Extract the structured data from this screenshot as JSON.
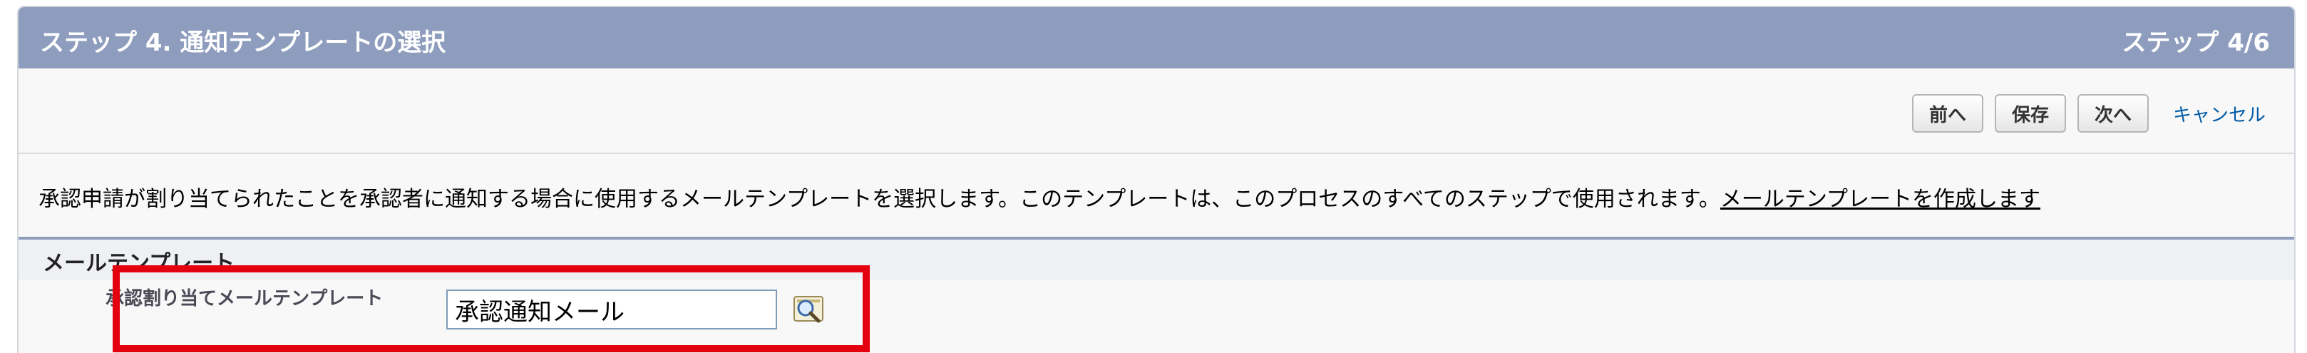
{
  "header": {
    "title": "ステップ 4. 通知テンプレートの選択",
    "step": "ステップ 4/6"
  },
  "buttons": {
    "prev_label": "前へ",
    "save_label": "保存",
    "next_label": "次へ",
    "cancel_label": "キャンセル"
  },
  "description": {
    "text": "承認申請が割り当てられたことを承認者に通知する場合に使用するメールテンプレートを選択します。このテンプレートは、このプロセスのすべてのステップで使用されます。",
    "link_text": "メールテンプレートを作成します"
  },
  "section": {
    "title": "メールテンプレート"
  },
  "field": {
    "label": "承認割り当てメールテンプレート",
    "value": "承認通知メール",
    "lookup_icon": "lookup-magnifier-icon"
  },
  "colors": {
    "header_bg": "#8e9dbe",
    "link": "#015ba7",
    "highlight_border": "#e3000f"
  }
}
